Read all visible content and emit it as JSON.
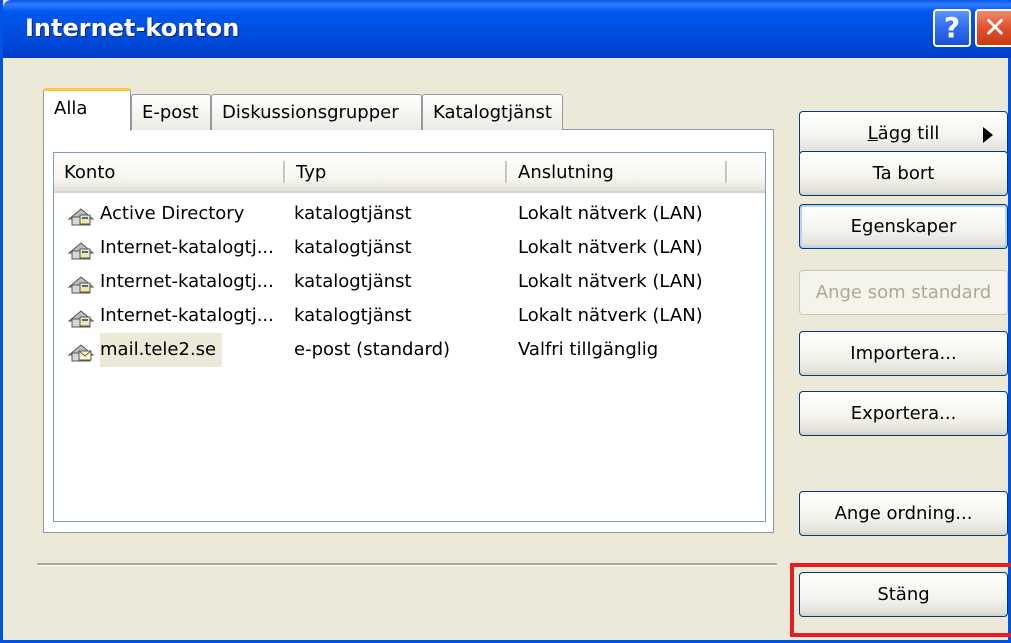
{
  "window": {
    "title": "Internet-konton"
  },
  "titlebar": {
    "help": "?",
    "close": "✕"
  },
  "tabs": [
    {
      "label": "Alla",
      "active": true
    },
    {
      "label": "E-post",
      "active": false
    },
    {
      "label": "Diskussionsgrupper",
      "active": false
    },
    {
      "label": "Katalogtjänst",
      "active": false
    }
  ],
  "list": {
    "columns": [
      "Konto",
      "Typ",
      "Anslutning"
    ],
    "rows": [
      {
        "konto": "Active Directory",
        "typ": "katalogtjänst",
        "anslutning": "Lokalt nätverk (LAN)",
        "icon": "directory-service-icon"
      },
      {
        "konto": "Internet-katalogtj...",
        "typ": "katalogtjänst",
        "anslutning": "Lokalt nätverk (LAN)",
        "icon": "directory-service-icon"
      },
      {
        "konto": "Internet-katalogtj...",
        "typ": "katalogtjänst",
        "anslutning": "Lokalt nätverk (LAN)",
        "icon": "directory-service-icon"
      },
      {
        "konto": "Internet-katalogtj...",
        "typ": "katalogtjänst",
        "anslutning": "Lokalt nätverk (LAN)",
        "icon": "directory-service-icon"
      },
      {
        "konto": "mail.tele2.se",
        "typ": "e-post (standard)",
        "anslutning": "Valfri tillgänglig",
        "icon": "mail-account-icon"
      }
    ]
  },
  "buttons": {
    "add": {
      "prefix": "L",
      "rest": "ägg till"
    },
    "remove": "Ta bort",
    "properties": "Egenskaper",
    "set_default": "Ange som standard",
    "import": "Importera...",
    "export": "Exportera...",
    "set_order": "Ange ordning...",
    "close": "Stäng"
  },
  "colors": {
    "titlebar": "#0054E3",
    "highlight": "#E31E24",
    "active_tab": "#FFC83C"
  }
}
